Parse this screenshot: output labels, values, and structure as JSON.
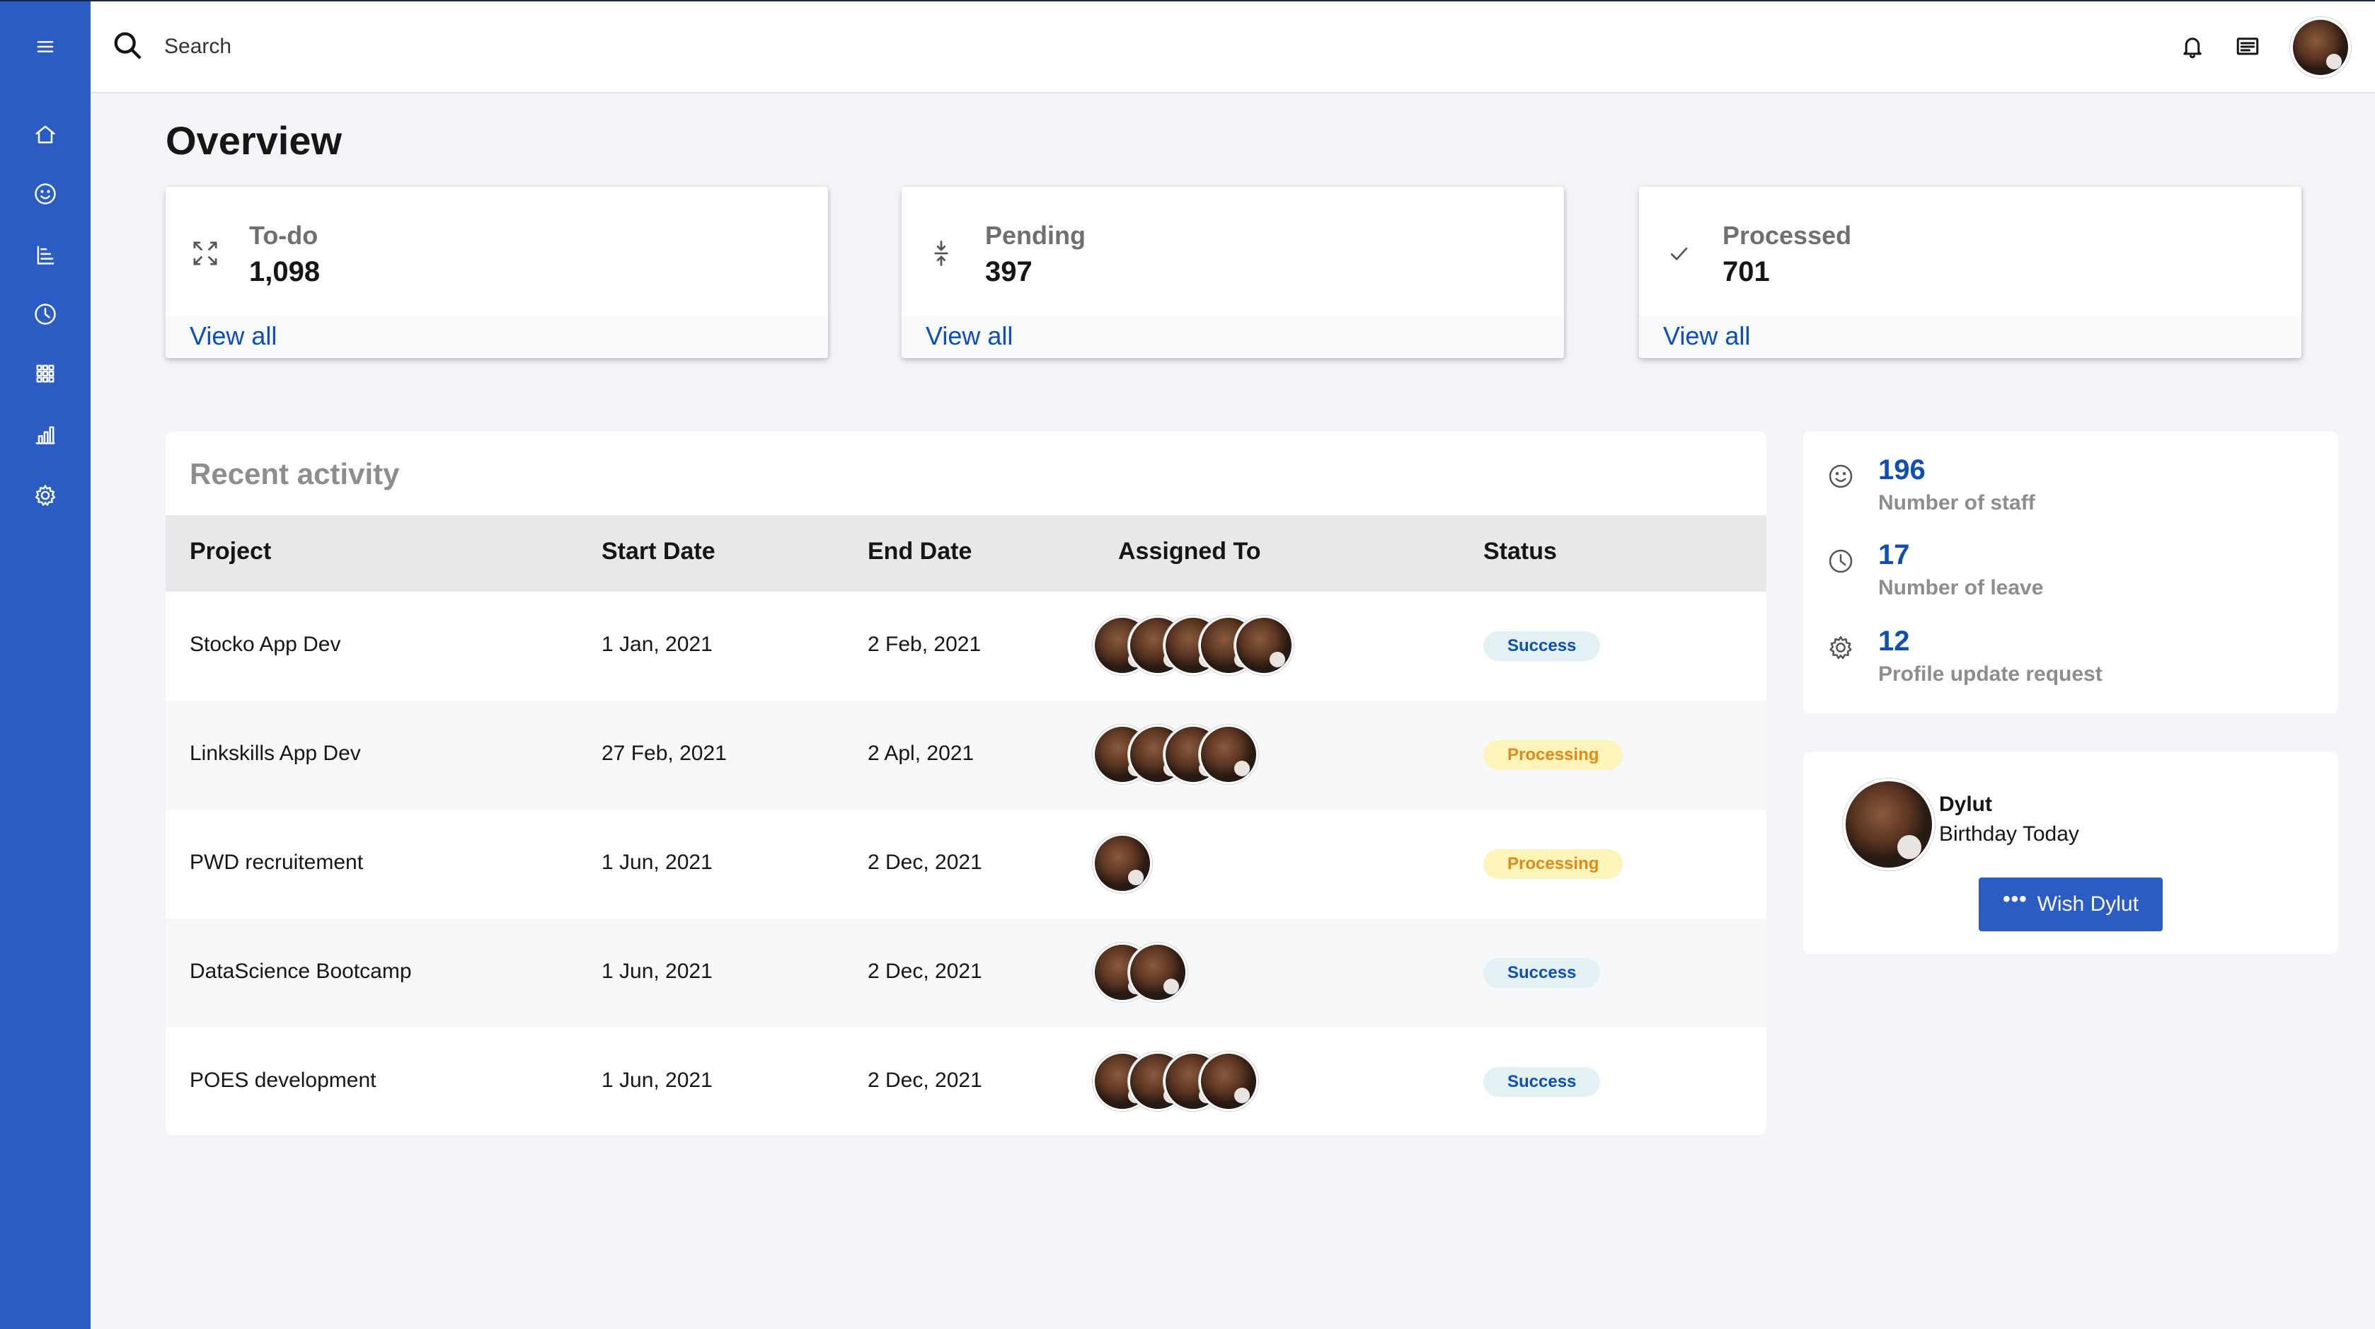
{
  "search": {
    "placeholder": "Search"
  },
  "sidebar": {
    "items": [
      {
        "icon": "menu-icon"
      },
      {
        "icon": "home-icon"
      },
      {
        "icon": "smiley-icon"
      },
      {
        "icon": "tree-view-icon"
      },
      {
        "icon": "clock-icon"
      },
      {
        "icon": "apps-grid-icon"
      },
      {
        "icon": "bar-chart-icon"
      },
      {
        "icon": "settings-icon"
      }
    ]
  },
  "header": {
    "notification_icon": "bell-icon",
    "messages_icon": "message-icon"
  },
  "page": {
    "title": "Overview"
  },
  "kpis": [
    {
      "icon": "maximize-icon",
      "label": "To-do",
      "value": "1,098",
      "link": "View all"
    },
    {
      "icon": "compress-icon",
      "label": "Pending",
      "value": "397",
      "link": "View all"
    },
    {
      "icon": "checkmark-icon",
      "label": "Processed",
      "value": "701",
      "link": "View all"
    }
  ],
  "activity": {
    "title": "Recent activity",
    "columns": [
      "Project",
      "Start Date",
      "End Date",
      "Assigned To",
      "Status"
    ],
    "rows": [
      {
        "project": "Stocko App Dev",
        "start": "1 Jan, 2021",
        "end": "2 Feb, 2021",
        "assignees": 5,
        "status": "Success"
      },
      {
        "project": "Linkskills App Dev",
        "start": "27 Feb, 2021",
        "end": "2 Apl, 2021",
        "assignees": 4,
        "status": "Processing"
      },
      {
        "project": "PWD recruitement",
        "start": "1 Jun, 2021",
        "end": "2 Dec, 2021",
        "assignees": 1,
        "status": "Processing"
      },
      {
        "project": "DataScience Bootcamp",
        "start": "1 Jun, 2021",
        "end": "2 Dec, 2021",
        "assignees": 2,
        "status": "Success"
      },
      {
        "project": "POES development",
        "start": "1 Jun, 2021",
        "end": "2 Dec, 2021",
        "assignees": 4,
        "status": "Success"
      }
    ]
  },
  "stats": [
    {
      "icon": "smiley-icon",
      "value": "196",
      "label": "Number of staff"
    },
    {
      "icon": "clock-icon",
      "value": "17",
      "label": "Number of leave"
    },
    {
      "icon": "settings-icon",
      "value": "12",
      "label": "Profile update request"
    }
  ],
  "birthday": {
    "name": "Dylut",
    "subtitle": "Birthday Today",
    "button_label": "Wish Dylut"
  },
  "colors": {
    "brand": "#2a5cc4",
    "link": "#0f4fb5",
    "success_bg": "#e3f0f4",
    "processing_bg": "#fcf4b8",
    "processing_text": "#e08a1a"
  }
}
